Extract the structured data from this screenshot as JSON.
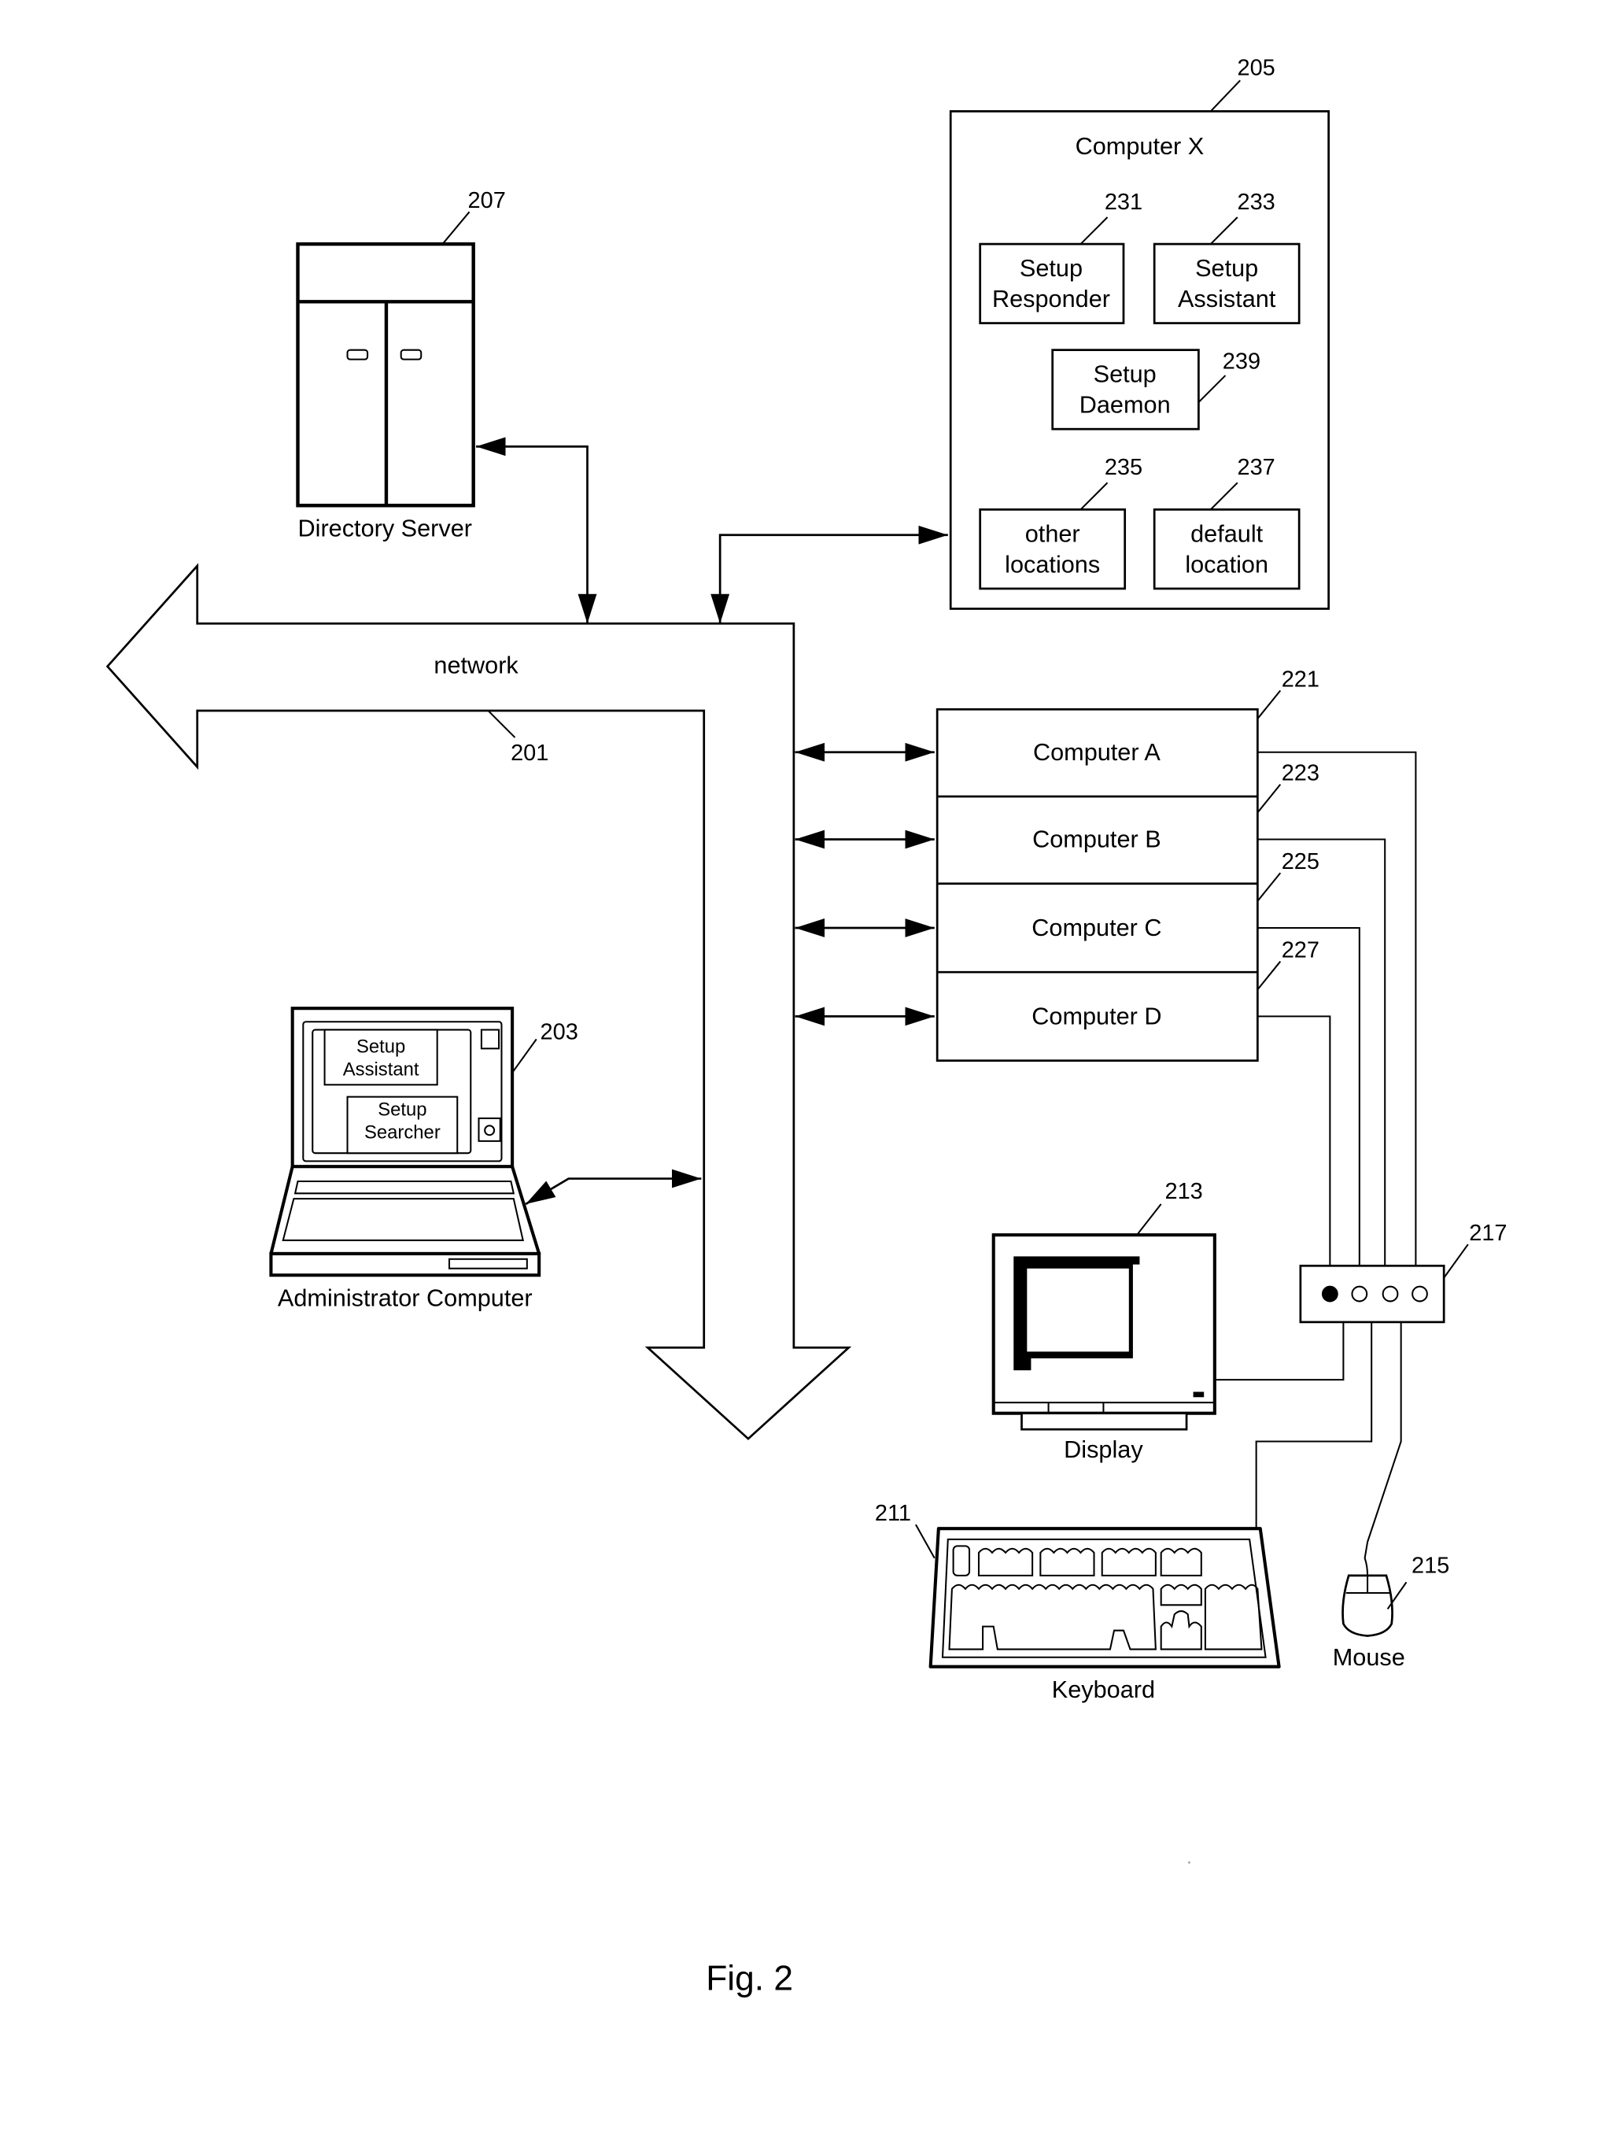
{
  "figure": {
    "caption": "Fig. 2",
    "network": {
      "label": "network",
      "ref": "201"
    },
    "directory_server": {
      "label": "Directory Server",
      "ref": "207"
    },
    "computer_x": {
      "title": "Computer X",
      "ref": "205",
      "modules": [
        {
          "line1": "Setup",
          "line2": "Responder",
          "ref": "231"
        },
        {
          "line1": "Setup",
          "line2": "Assistant",
          "ref": "233"
        },
        {
          "line1": "Setup",
          "line2": "Daemon",
          "ref": "239"
        },
        {
          "line1": "other",
          "line2": "locations",
          "ref": "235"
        },
        {
          "line1": "default",
          "line2": "location",
          "ref": "237"
        }
      ]
    },
    "computers": [
      {
        "label": "Computer A",
        "ref": "221"
      },
      {
        "label": "Computer B",
        "ref": "223"
      },
      {
        "label": "Computer C",
        "ref": "225"
      },
      {
        "label": "Computer D",
        "ref": "227"
      }
    ],
    "admin_computer": {
      "label": "Administrator Computer",
      "ref": "203",
      "windows": [
        {
          "line1": "Setup",
          "line2": "Assistant"
        },
        {
          "line1": "Setup",
          "line2": "Searcher"
        }
      ]
    },
    "display": {
      "label": "Display",
      "ref": "213"
    },
    "kvm_switch": {
      "ref": "217",
      "ports": 4,
      "active_port": 1
    },
    "keyboard": {
      "label": "Keyboard",
      "ref": "211"
    },
    "mouse": {
      "label": "Mouse",
      "ref": "215"
    }
  }
}
